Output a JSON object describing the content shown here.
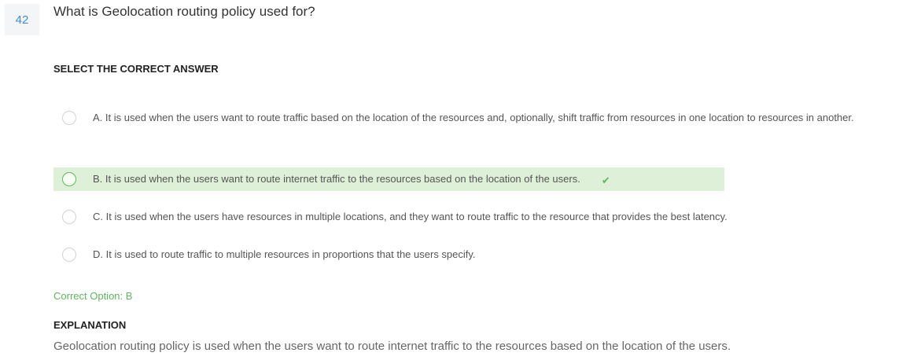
{
  "question": {
    "number": "42",
    "text": "What is Geolocation routing policy used for?"
  },
  "select_label": "SELECT THE CORRECT ANSWER",
  "options": [
    {
      "letter": "A.",
      "text": "It is used when the users want to route traffic based on the location of the resources and, optionally, shift traffic from resources in one location to resources in another."
    },
    {
      "letter": "B.",
      "text": "It is used when the users want to route internet traffic to the resources based on the location of the users.",
      "correct": true
    },
    {
      "letter": "C.",
      "text": "It is used when the users have resources in multiple locations, and they want to route traffic to the resource that provides the best latency."
    },
    {
      "letter": "D.",
      "text": "It is used to route traffic to multiple resources in proportions that the users specify."
    }
  ],
  "correct_option": "Correct Option: B",
  "explanation": {
    "title": "EXPLANATION",
    "text": "Geolocation routing policy is used when the users want to route internet traffic to the resources based on the location of the users."
  },
  "colors": {
    "correct_bg": "#dff0d8",
    "correct_text": "#5cb85c",
    "question_number": "#3d8fd6"
  },
  "icons": {
    "correct_mark": "check-icon"
  }
}
